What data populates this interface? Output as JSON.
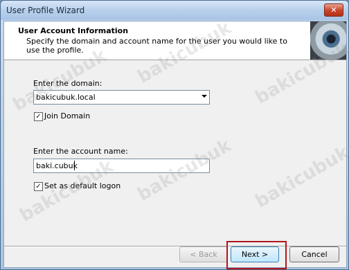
{
  "window": {
    "title": "User Profile Wizard",
    "close_symbol": "✕"
  },
  "header": {
    "title": "User Account Information",
    "description": "Specify the domain and account name for the user you would like to use the profile."
  },
  "domain": {
    "label": "Enter the domain:",
    "value": "bakicubuk.local",
    "join_label": "Join Domain",
    "join_checked": true
  },
  "account": {
    "label": "Enter the account name:",
    "value": "baki.cubuk",
    "default_logon_label": "Set as default logon",
    "default_logon_checked": true
  },
  "buttons": {
    "back": "< Back",
    "next": "Next >",
    "cancel": "Cancel"
  },
  "watermark": "bakicubuk",
  "colors": {
    "highlight": "#b0151b",
    "close_button": "#c7432a"
  }
}
